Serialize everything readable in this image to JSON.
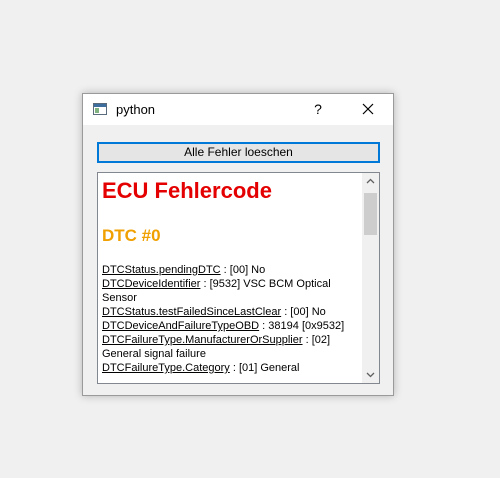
{
  "window": {
    "title": "python",
    "help_symbol": "?"
  },
  "toolbar": {
    "delete_all_label": "Alle Fehler loeschen"
  },
  "report": {
    "heading": "ECU Fehlercode",
    "dtc_heading": "DTC #0",
    "entries": [
      {
        "key": "DTCStatus.pendingDTC",
        "value": " : [00] No"
      },
      {
        "key": "DTCDeviceIdentifier",
        "value": " : [9532] VSC BCM Optical Sensor"
      },
      {
        "key": "DTCStatus.testFailedSinceLastClear",
        "value": " : [00] No"
      },
      {
        "key": "DTCDeviceAndFailureTypeOBD",
        "value": " : 38194 [0x9532]"
      },
      {
        "key": "DTCFailureType.ManufacturerOrSupplier",
        "value": " : [02] General signal failure"
      },
      {
        "key": "DTCFailureType.Category",
        "value": " : [01] General"
      }
    ]
  },
  "icons": {
    "app": "python-window-icon",
    "close": "close-icon",
    "scroll_up": "chevron-up-icon",
    "scroll_down": "chevron-down-icon"
  },
  "colors": {
    "heading": "#e40000",
    "dtc_heading": "#f0a000",
    "focus_border": "#0078d7"
  }
}
